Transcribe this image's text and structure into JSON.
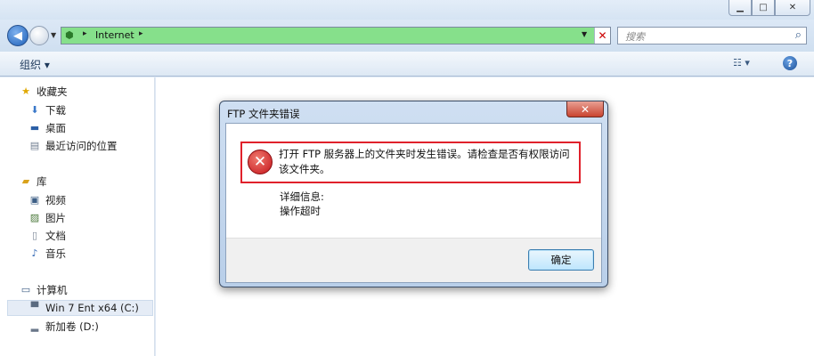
{
  "window": {
    "controls": {
      "minimize": "▁",
      "maximize": "□",
      "close": "✕"
    }
  },
  "address": {
    "crumbs": [
      "Internet"
    ],
    "stop": "✕"
  },
  "search": {
    "placeholder": "搜索"
  },
  "toolbar": {
    "organize": "组织 ▾",
    "view": "☷ ▾",
    "help": "?"
  },
  "navpane": {
    "favorites": {
      "label": "收藏夹",
      "items": [
        "下载",
        "桌面",
        "最近访问的位置"
      ]
    },
    "libraries": {
      "label": "库",
      "items": [
        "视频",
        "图片",
        "文档",
        "音乐"
      ]
    },
    "computer": {
      "label": "计算机",
      "items": [
        "Win 7 Ent x64 (C:)",
        "新加卷 (D:)"
      ]
    }
  },
  "dialog": {
    "title": "FTP 文件夹错误",
    "close": "✕",
    "message": "打开 FTP 服务器上的文件夹时发生错误。请检查是否有权限访问该文件夹。",
    "detail_label": "详细信息:",
    "detail_text": "操作超时",
    "ok_label": "确定"
  },
  "colors": {
    "error_highlight": "#e0212b",
    "address_fill": "#86e08b"
  }
}
